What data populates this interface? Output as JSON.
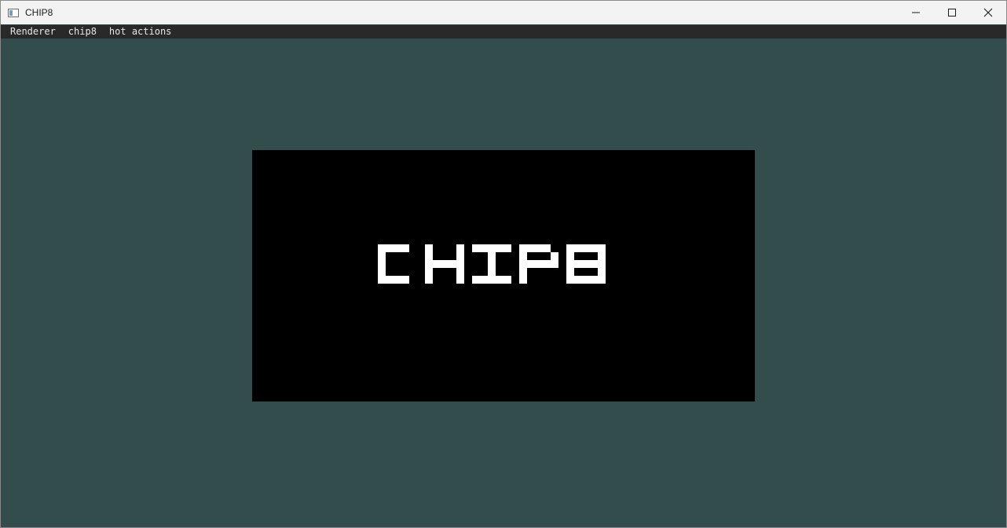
{
  "window": {
    "title": "CHIP8",
    "colors": {
      "background": "#334d4d",
      "titlebar": "#f3f3f3",
      "menubar": "#292929",
      "menu_text": "#e6e6e6",
      "display_off": "#000000",
      "display_on": "#ffffff"
    },
    "controls": {
      "minimize_icon": "minimize-icon",
      "maximize_icon": "maximize-icon",
      "close_icon": "close-icon"
    }
  },
  "menubar": {
    "items": [
      {
        "label": "Renderer"
      },
      {
        "label": "chip8"
      },
      {
        "label": "hot actions"
      }
    ]
  },
  "display": {
    "resolution": "64x32",
    "text": "CHIP8"
  }
}
